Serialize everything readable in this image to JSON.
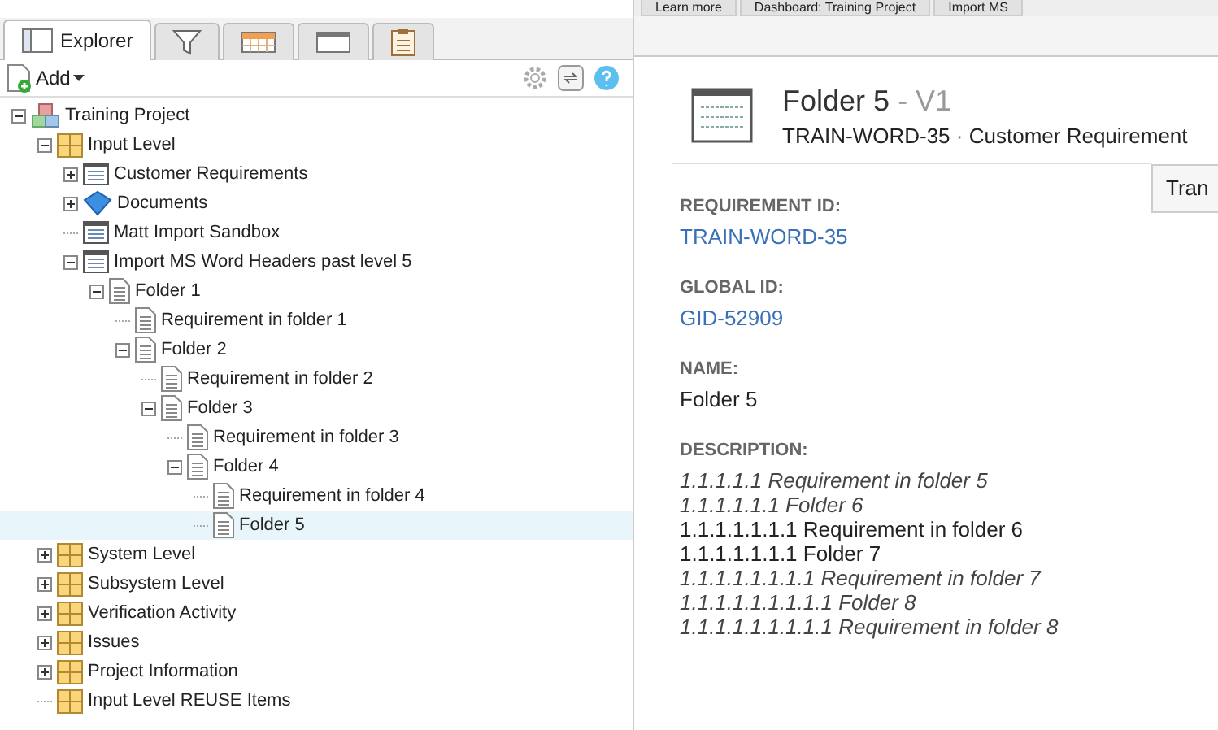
{
  "explorer": {
    "tabs": [
      {
        "kind": "explorer",
        "label": "Explorer",
        "selected": true
      },
      {
        "kind": "filter",
        "selected": false
      },
      {
        "kind": "calendar",
        "selected": false
      },
      {
        "kind": "window",
        "selected": false
      },
      {
        "kind": "clipboard",
        "selected": false
      }
    ],
    "add_button": "Add",
    "tree": [
      {
        "label": "Training Project",
        "kind": "project",
        "expanded": true,
        "selected": false,
        "children": [
          {
            "label": "Input Level",
            "kind": "level",
            "expanded": true,
            "selected": false,
            "children": [
              {
                "label": "Customer Requirements",
                "kind": "module",
                "expanded": false,
                "selected": false
              },
              {
                "label": "Documents",
                "kind": "documents",
                "expanded": false,
                "selected": false
              },
              {
                "label": "Matt Import Sandbox",
                "kind": "module",
                "selected": false
              },
              {
                "label": "Import MS Word Headers past level 5",
                "kind": "module",
                "expanded": true,
                "selected": false,
                "children": [
                  {
                    "label": "Folder 1",
                    "kind": "page",
                    "expanded": true,
                    "selected": false,
                    "children": [
                      {
                        "label": "Requirement in folder 1",
                        "kind": "page",
                        "selected": false
                      },
                      {
                        "label": "Folder 2",
                        "kind": "page",
                        "expanded": true,
                        "selected": false,
                        "children": [
                          {
                            "label": "Requirement in folder 2",
                            "kind": "page",
                            "selected": false
                          },
                          {
                            "label": "Folder 3",
                            "kind": "page",
                            "expanded": true,
                            "selected": false,
                            "children": [
                              {
                                "label": "Requirement in folder 3",
                                "kind": "page",
                                "selected": false
                              },
                              {
                                "label": "Folder 4",
                                "kind": "page",
                                "expanded": true,
                                "selected": false,
                                "children": [
                                  {
                                    "label": "Requirement in folder 4",
                                    "kind": "page",
                                    "selected": false
                                  },
                                  {
                                    "label": "Folder 5",
                                    "kind": "page",
                                    "selected": true
                                  }
                                ]
                              }
                            ]
                          }
                        ]
                      }
                    ]
                  }
                ]
              }
            ]
          },
          {
            "label": "System Level",
            "kind": "level",
            "expanded": false,
            "selected": false
          },
          {
            "label": "Subsystem Level",
            "kind": "level",
            "expanded": false,
            "selected": false
          },
          {
            "label": "Verification Activity",
            "kind": "level",
            "expanded": false,
            "selected": false
          },
          {
            "label": "Issues",
            "kind": "level",
            "expanded": false,
            "selected": false
          },
          {
            "label": "Project Information",
            "kind": "level",
            "expanded": false,
            "selected": false
          },
          {
            "label": "Input Level REUSE Items",
            "kind": "level",
            "selected": false
          }
        ]
      }
    ]
  },
  "top_tabs": [
    "Learn more",
    "Dashboard: Training Project",
    "Import MS"
  ],
  "detail": {
    "title": "Folder 5",
    "version": "- V1",
    "item_id": "TRAIN-WORD-35",
    "separator": "·",
    "item_type": "Customer Requirement",
    "side_button": "Tran",
    "fields": [
      {
        "label": "REQUIREMENT ID:",
        "value": "TRAIN-WORD-35",
        "kind": "link"
      },
      {
        "label": "GLOBAL ID:",
        "value": "GID-52909",
        "kind": "link"
      },
      {
        "label": "NAME:",
        "value": "Folder 5",
        "kind": "text"
      }
    ],
    "description_label": "DESCRIPTION:",
    "description": [
      {
        "text": "1.1.1.1.1 Requirement in folder 5",
        "italic": true
      },
      {
        "text": "1.1.1.1.1.1 Folder 6",
        "italic": true
      },
      {
        "text": "1.1.1.1.1.1.1 Requirement in folder 6",
        "italic": false
      },
      {
        "text": "1.1.1.1.1.1.1 Folder 7",
        "italic": false
      },
      {
        "text": "1.1.1.1.1.1.1.1 Requirement in folder 7",
        "italic": true
      },
      {
        "text": "1.1.1.1.1.1.1.1.1 Folder 8",
        "italic": true
      },
      {
        "text": "1.1.1.1.1.1.1.1.1 Requirement in folder 8",
        "italic": true
      }
    ]
  }
}
